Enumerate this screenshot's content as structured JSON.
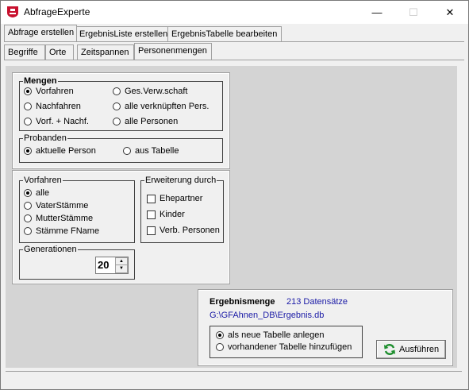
{
  "window": {
    "title": "AbfrageExperte",
    "minimize_glyph": "—",
    "maximize_glyph": "☐",
    "close_glyph": "✕",
    "app_icon": "red-badge-icon"
  },
  "main_tabs": [
    {
      "label": "Abfrage erstellen"
    },
    {
      "label": "ErgebnisListe erstellen"
    },
    {
      "label": "ErgebnisTabelle bearbeiten"
    }
  ],
  "sub_tabs": [
    {
      "label": "Begriffe"
    },
    {
      "label": "Orte"
    },
    {
      "label": "Zeitspannen"
    },
    {
      "label": "Personenmengen"
    }
  ],
  "mengen": {
    "legend": "Mengen",
    "options": [
      {
        "label": "Vorfahren",
        "selected": true
      },
      {
        "label": "Nachfahren",
        "selected": false
      },
      {
        "label": "Vorf. + Nachf.",
        "selected": false
      },
      {
        "label": "Ges.Verw.schaft",
        "selected": false
      },
      {
        "label": "alle verknüpften Pers.",
        "selected": false
      },
      {
        "label": "alle Personen",
        "selected": false
      }
    ]
  },
  "probanden": {
    "legend": "Probanden",
    "options": [
      {
        "label": "aktuelle Person",
        "selected": true
      },
      {
        "label": "aus Tabelle",
        "selected": false
      }
    ]
  },
  "vorfahren": {
    "legend": "Vorfahren",
    "options": [
      {
        "label": "alle",
        "selected": true
      },
      {
        "label": "VaterStämme",
        "selected": false
      },
      {
        "label": "MutterStämme",
        "selected": false
      },
      {
        "label": "Stämme FName",
        "selected": false
      }
    ]
  },
  "erweiterung": {
    "legend": "Erweiterung durch",
    "options": [
      {
        "label": "Ehepartner",
        "checked": false
      },
      {
        "label": "Kinder",
        "checked": false
      },
      {
        "label": "Verb. Personen",
        "checked": false
      }
    ]
  },
  "generationen": {
    "legend": "Generationen",
    "value": "20"
  },
  "ergebnis": {
    "title": "Ergebnismenge",
    "count": "213 Datensätze",
    "path": "G:\\GFAhnen_DB\\Ergebnis.db",
    "options": [
      {
        "label": "als neue Tabelle anlegen",
        "selected": true
      },
      {
        "label": "vorhandener Tabelle hinzufügen",
        "selected": false
      }
    ],
    "run_button": "Ausführen",
    "run_icon": "refresh-icon"
  }
}
